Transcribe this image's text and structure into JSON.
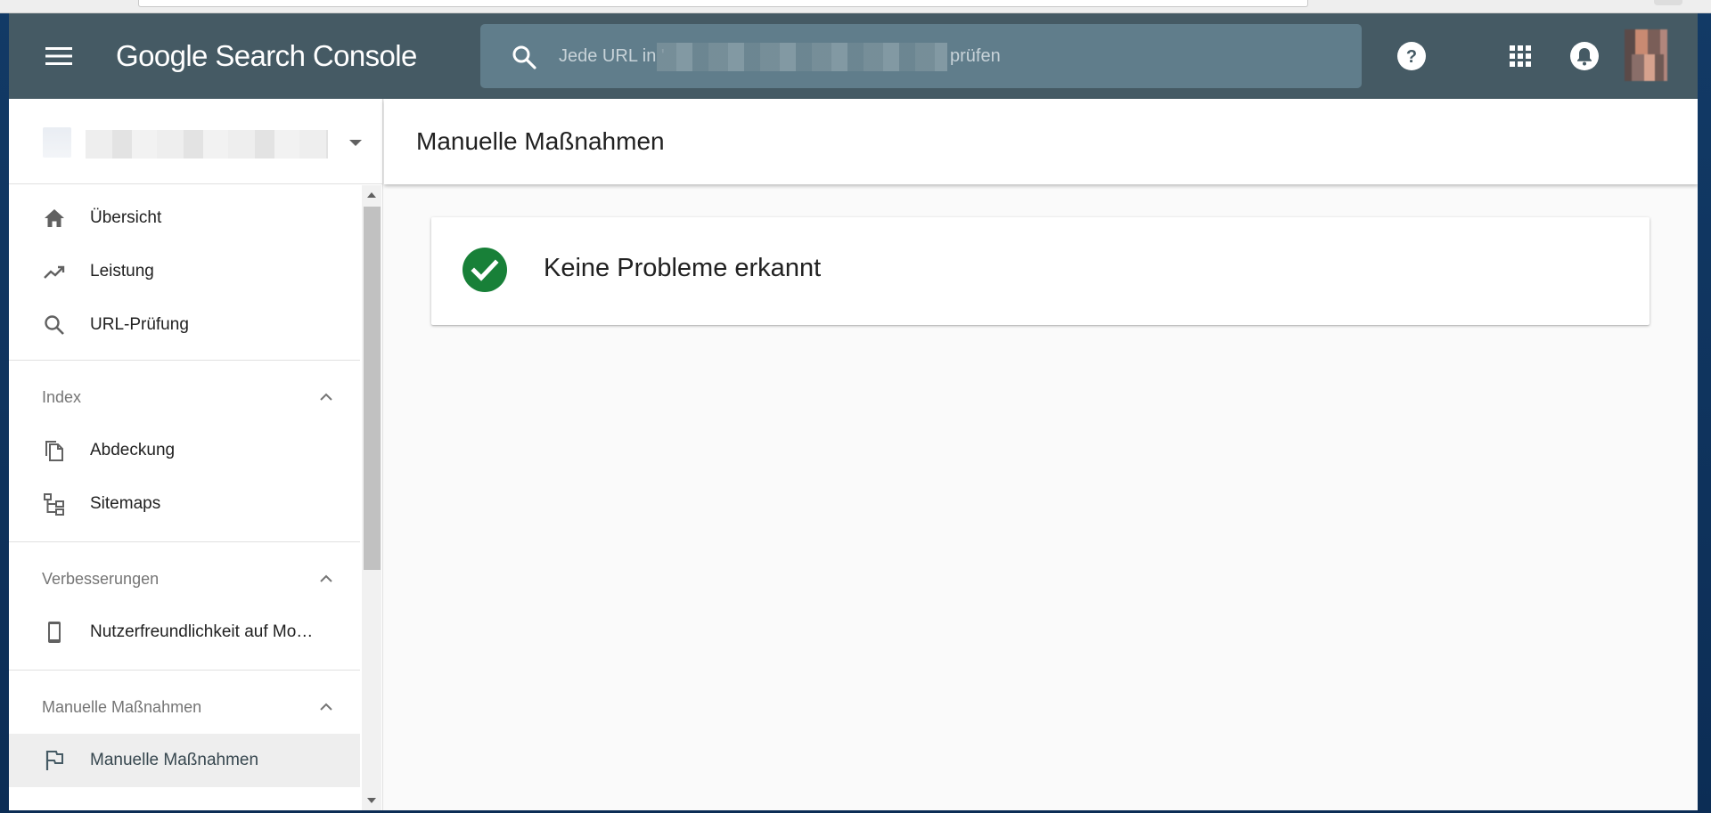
{
  "app": {
    "title": "Google Search Console"
  },
  "search": {
    "placeholder_prefix": "Jede URL in '",
    "placeholder_suffix": "prüfen"
  },
  "topbar": {
    "icons": [
      "menu-icon",
      "search-icon",
      "help-icon",
      "apps-icon",
      "notifications-icon",
      "avatar"
    ]
  },
  "sidebar": {
    "primary": [
      {
        "label": "Übersicht",
        "icon": "home-icon"
      },
      {
        "label": "Leistung",
        "icon": "trending-up-icon"
      },
      {
        "label": "URL-Prüfung",
        "icon": "search-icon"
      }
    ],
    "sections": [
      {
        "title": "Index",
        "items": [
          {
            "label": "Abdeckung",
            "icon": "copy-pages-icon"
          },
          {
            "label": "Sitemaps",
            "icon": "sitemap-icon"
          }
        ]
      },
      {
        "title": "Verbesserungen",
        "items": [
          {
            "label": "Nutzerfreundlichkeit auf Mo…",
            "icon": "smartphone-icon"
          }
        ]
      },
      {
        "title": "Manuelle Maßnahmen",
        "items": [
          {
            "label": "Manuelle Maßnahmen",
            "icon": "flag-icon",
            "active": true
          }
        ]
      }
    ]
  },
  "main": {
    "page_title": "Manuelle Maßnahmen",
    "status_card": {
      "text": "Keine Probleme erkannt",
      "icon": "check-circle-icon",
      "color": "#188038"
    }
  },
  "colors": {
    "topbar": "#455a64",
    "search_bg": "#607d8b",
    "success": "#188038"
  }
}
